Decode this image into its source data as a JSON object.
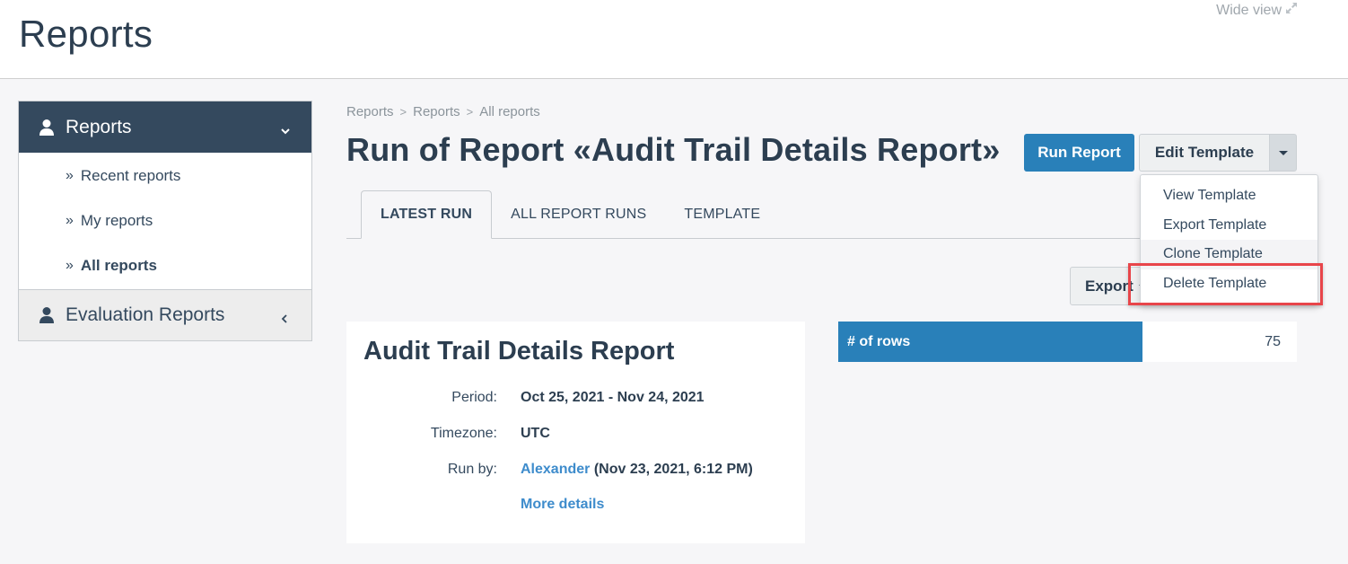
{
  "header": {
    "app_title": "Reports",
    "wide_view_label": "Wide view",
    "wide_view_icon": "expand-arrows-icon"
  },
  "sidebar": {
    "section": {
      "label": "Reports",
      "icon": "user-icon",
      "chevron": "chevron-down-icon",
      "items": [
        {
          "label": "Recent reports",
          "active": false
        },
        {
          "label": "My reports",
          "active": false
        },
        {
          "label": "All reports",
          "active": true
        }
      ]
    },
    "collapsed_section": {
      "label": "Evaluation Reports",
      "icon": "user-icon",
      "chevron": "chevron-left-icon"
    },
    "bullet": "»"
  },
  "breadcrumb": {
    "items": [
      "Reports",
      "Reports",
      "All reports"
    ],
    "separator": ">"
  },
  "page": {
    "title": "Run of Report «Audit Trail Details Report»"
  },
  "toolbar": {
    "run_report_label": "Run Report",
    "edit_template_label": "Edit Template",
    "export_label": "Export"
  },
  "template_menu": {
    "items": [
      {
        "label": "View Template"
      },
      {
        "label": "Export Template"
      },
      {
        "label": "Clone Template",
        "hovered": true
      },
      {
        "label": "Delete Template",
        "highlighted": true
      }
    ]
  },
  "tabs": [
    {
      "label": "LATEST RUN",
      "active": true
    },
    {
      "label": "ALL REPORT RUNS",
      "active": false
    },
    {
      "label": "TEMPLATE",
      "active": false
    }
  ],
  "report_card": {
    "title": "Audit Trail Details Report",
    "period_label": "Period:",
    "period_value": "Oct 25, 2021 - Nov 24, 2021",
    "timezone_label": "Timezone:",
    "timezone_value": "UTC",
    "run_by_label": "Run by:",
    "run_by_user": "Alexander",
    "run_by_time": "(Nov 23, 2021, 6:12 PM)",
    "more_details_label": "More details"
  },
  "stats": {
    "rows_label": "# of rows",
    "rows_value": "75"
  },
  "colors": {
    "primary": "#2980b9",
    "sidebar_header": "#34495e",
    "link": "#3e8ccc",
    "highlight": "#e8454a",
    "text": "#2c3e50"
  }
}
